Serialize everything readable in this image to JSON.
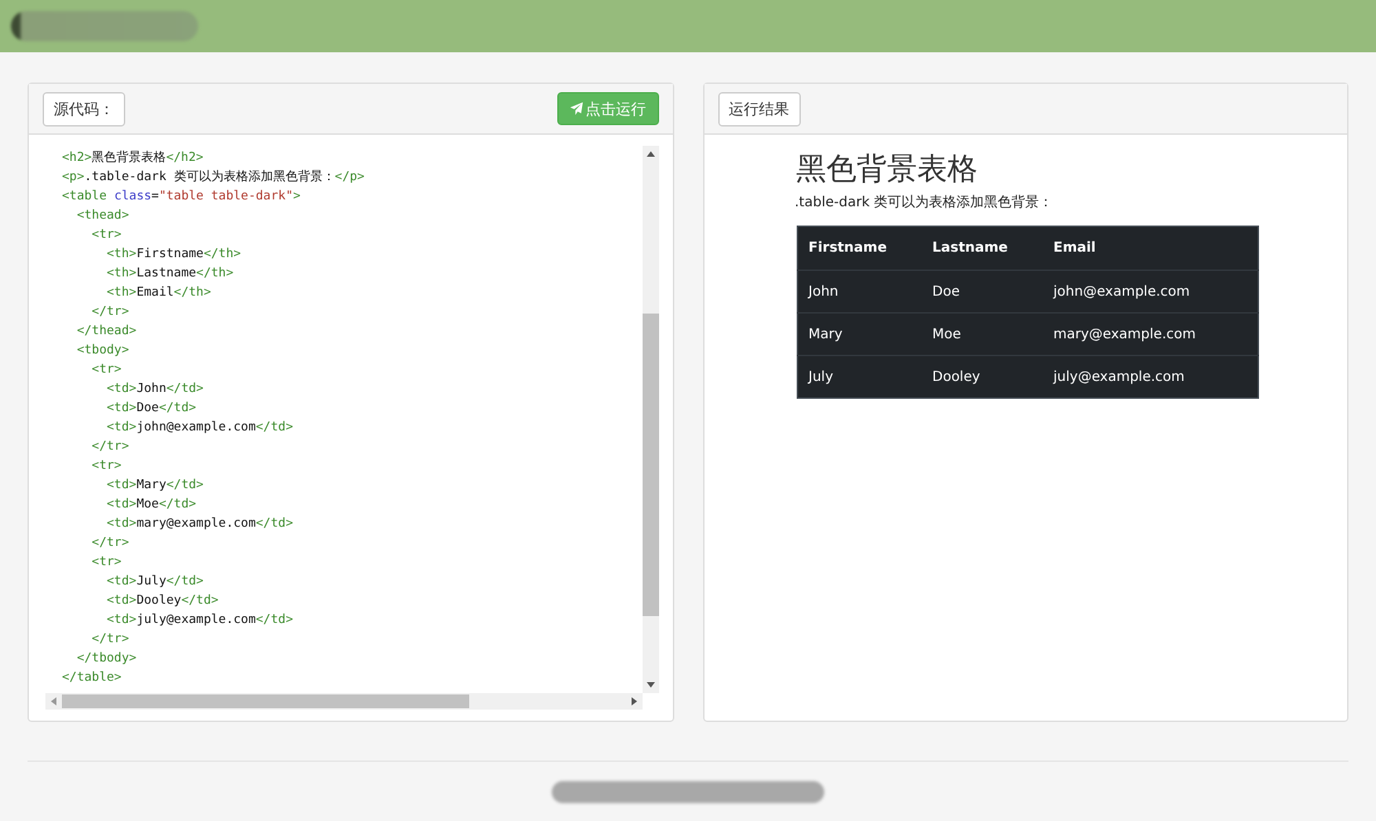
{
  "source_panel": {
    "label": "源代码：",
    "run_button": "点击运行",
    "code_lines": [
      [
        {
          "kind": "tag",
          "text": "<h2>"
        },
        {
          "kind": "text",
          "text": "黑色背景表格"
        },
        {
          "kind": "tag",
          "text": "</h2>"
        }
      ],
      [
        {
          "kind": "tag",
          "text": "<p>"
        },
        {
          "kind": "text",
          "text": ".table-dark 类可以为表格添加黑色背景："
        },
        {
          "kind": "tag",
          "text": "</p>"
        }
      ],
      [
        {
          "kind": "tag",
          "text": "<table "
        },
        {
          "kind": "attr",
          "text": "class"
        },
        {
          "kind": "text",
          "text": "="
        },
        {
          "kind": "string",
          "text": "\"table table-dark\""
        },
        {
          "kind": "tag",
          "text": ">"
        }
      ],
      [
        {
          "kind": "tag",
          "text": "  <thead>"
        }
      ],
      [
        {
          "kind": "tag",
          "text": "    <tr>"
        }
      ],
      [
        {
          "kind": "tag",
          "text": "      <th>"
        },
        {
          "kind": "text",
          "text": "Firstname"
        },
        {
          "kind": "tag",
          "text": "</th>"
        }
      ],
      [
        {
          "kind": "tag",
          "text": "      <th>"
        },
        {
          "kind": "text",
          "text": "Lastname"
        },
        {
          "kind": "tag",
          "text": "</th>"
        }
      ],
      [
        {
          "kind": "tag",
          "text": "      <th>"
        },
        {
          "kind": "text",
          "text": "Email"
        },
        {
          "kind": "tag",
          "text": "</th>"
        }
      ],
      [
        {
          "kind": "tag",
          "text": "    </tr>"
        }
      ],
      [
        {
          "kind": "tag",
          "text": "  </thead>"
        }
      ],
      [
        {
          "kind": "tag",
          "text": "  <tbody>"
        }
      ],
      [
        {
          "kind": "tag",
          "text": "    <tr>"
        }
      ],
      [
        {
          "kind": "tag",
          "text": "      <td>"
        },
        {
          "kind": "text",
          "text": "John"
        },
        {
          "kind": "tag",
          "text": "</td>"
        }
      ],
      [
        {
          "kind": "tag",
          "text": "      <td>"
        },
        {
          "kind": "text",
          "text": "Doe"
        },
        {
          "kind": "tag",
          "text": "</td>"
        }
      ],
      [
        {
          "kind": "tag",
          "text": "      <td>"
        },
        {
          "kind": "text",
          "text": "john@example.com"
        },
        {
          "kind": "tag",
          "text": "</td>"
        }
      ],
      [
        {
          "kind": "tag",
          "text": "    </tr>"
        }
      ],
      [
        {
          "kind": "tag",
          "text": "    <tr>"
        }
      ],
      [
        {
          "kind": "tag",
          "text": "      <td>"
        },
        {
          "kind": "text",
          "text": "Mary"
        },
        {
          "kind": "tag",
          "text": "</td>"
        }
      ],
      [
        {
          "kind": "tag",
          "text": "      <td>"
        },
        {
          "kind": "text",
          "text": "Moe"
        },
        {
          "kind": "tag",
          "text": "</td>"
        }
      ],
      [
        {
          "kind": "tag",
          "text": "      <td>"
        },
        {
          "kind": "text",
          "text": "mary@example.com"
        },
        {
          "kind": "tag",
          "text": "</td>"
        }
      ],
      [
        {
          "kind": "tag",
          "text": "    </tr>"
        }
      ],
      [
        {
          "kind": "tag",
          "text": "    <tr>"
        }
      ],
      [
        {
          "kind": "tag",
          "text": "      <td>"
        },
        {
          "kind": "text",
          "text": "July"
        },
        {
          "kind": "tag",
          "text": "</td>"
        }
      ],
      [
        {
          "kind": "tag",
          "text": "      <td>"
        },
        {
          "kind": "text",
          "text": "Dooley"
        },
        {
          "kind": "tag",
          "text": "</td>"
        }
      ],
      [
        {
          "kind": "tag",
          "text": "      <td>"
        },
        {
          "kind": "text",
          "text": "july@example.com"
        },
        {
          "kind": "tag",
          "text": "</td>"
        }
      ],
      [
        {
          "kind": "tag",
          "text": "    </tr>"
        }
      ],
      [
        {
          "kind": "tag",
          "text": "  </tbody>"
        }
      ],
      [
        {
          "kind": "tag",
          "text": "</table>"
        }
      ]
    ]
  },
  "result_panel": {
    "label": "运行结果",
    "heading": "黑色背景表格",
    "paragraph": ".table-dark 类可以为表格添加黑色背景：",
    "table": {
      "columns": [
        "Firstname",
        "Lastname",
        "Email"
      ],
      "rows": [
        [
          "John",
          "Doe",
          "john@example.com"
        ],
        [
          "Mary",
          "Moe",
          "mary@example.com"
        ],
        [
          "July",
          "Dooley",
          "july@example.com"
        ]
      ]
    }
  }
}
